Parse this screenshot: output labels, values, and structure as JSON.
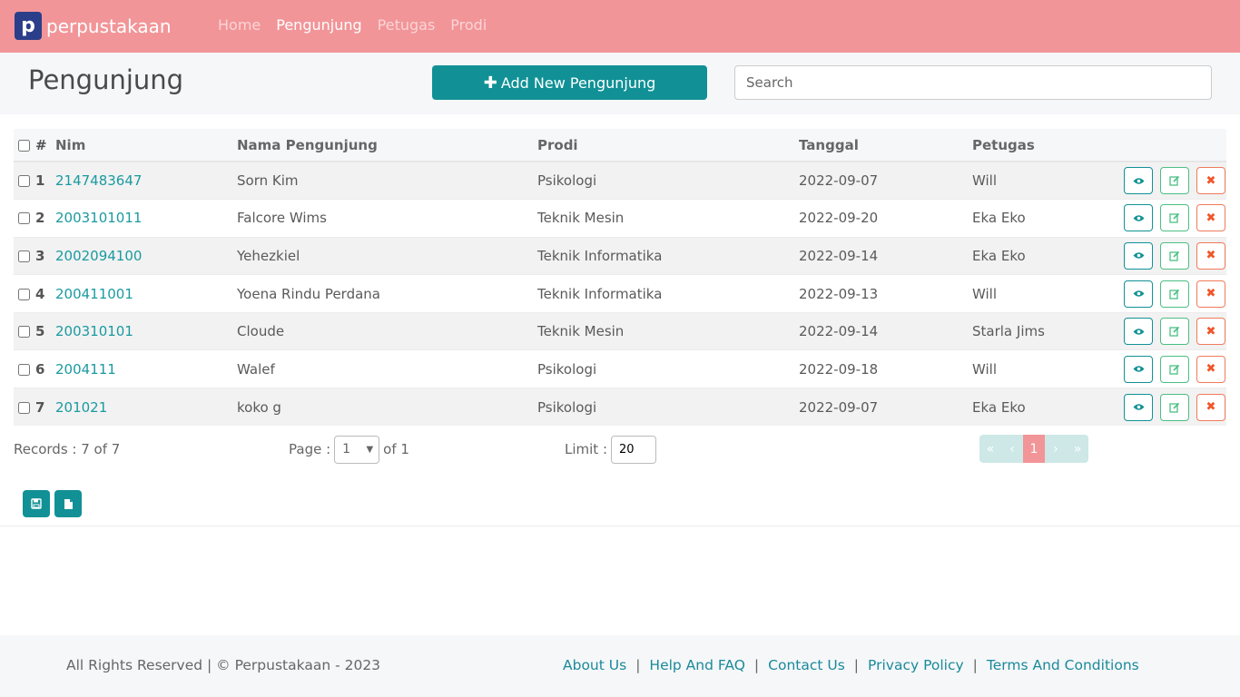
{
  "nav": {
    "brand_letter": "p",
    "brand_text": "perpustakaan",
    "links": [
      {
        "label": "Home",
        "active": false
      },
      {
        "label": "Pengunjung",
        "active": true
      },
      {
        "label": "Petugas",
        "active": false
      },
      {
        "label": "Prodi",
        "active": false
      }
    ]
  },
  "header": {
    "title": "Pengunjung",
    "add_button": "Add New Pengunjung",
    "search_placeholder": "Search"
  },
  "table": {
    "columns": [
      "#",
      "Nim",
      "Nama Pengunjung",
      "Prodi",
      "Tanggal",
      "Petugas"
    ],
    "rows": [
      {
        "no": "1",
        "nim": "2147483647",
        "nama": "Sorn Kim",
        "prodi": "Psikologi",
        "tanggal": "2022-09-07",
        "petugas": "Will"
      },
      {
        "no": "2",
        "nim": "2003101011",
        "nama": "Falcore Wims",
        "prodi": "Teknik Mesin",
        "tanggal": "2022-09-20",
        "petugas": "Eka Eko"
      },
      {
        "no": "3",
        "nim": "2002094100",
        "nama": "Yehezkiel",
        "prodi": "Teknik Informatika",
        "tanggal": "2022-09-14",
        "petugas": "Eka Eko"
      },
      {
        "no": "4",
        "nim": "200411001",
        "nama": "Yoena Rindu Perdana",
        "prodi": "Teknik Informatika",
        "tanggal": "2022-09-13",
        "petugas": "Will"
      },
      {
        "no": "5",
        "nim": "200310101",
        "nama": "Cloude",
        "prodi": "Teknik Mesin",
        "tanggal": "2022-09-14",
        "petugas": "Starla Jims"
      },
      {
        "no": "6",
        "nim": "2004111",
        "nama": "Walef",
        "prodi": "Psikologi",
        "tanggal": "2022-09-18",
        "petugas": "Will"
      },
      {
        "no": "7",
        "nim": "201021",
        "nama": "koko g",
        "prodi": "Psikologi",
        "tanggal": "2022-09-07",
        "petugas": "Eka Eko"
      }
    ]
  },
  "pagination": {
    "records": "Records : 7 of 7",
    "page_label": "Page :",
    "page_value": "1",
    "of_label": "of 1",
    "limit_label": "Limit :",
    "limit_value": "20",
    "first": "«",
    "prev": "‹",
    "current": "1",
    "next": "›",
    "last": "»"
  },
  "footer": {
    "copyright": "All Rights Reserved | © Perpustakaan - 2023",
    "links": [
      "About Us",
      "Help And FAQ",
      "Contact Us",
      "Privacy Policy",
      "Terms And Conditions"
    ]
  },
  "colors": {
    "navbar": "#f29598",
    "accent": "#119196",
    "edit": "#4cbf84",
    "delete": "#f0552a"
  },
  "icons": {
    "view": "eye-icon",
    "edit": "edit-icon",
    "delete": "close-icon",
    "export1": "save-icon",
    "export2": "file-icon"
  }
}
